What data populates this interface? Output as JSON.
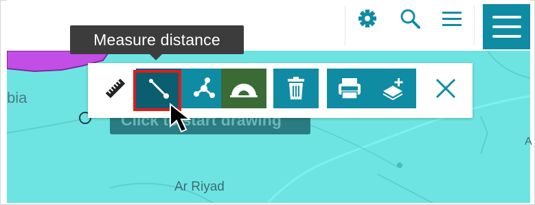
{
  "header": {
    "settings_icon": "gear-icon",
    "search_icon": "search-icon",
    "list_icon": "list-icon",
    "menu_icon": "hamburger-menu-icon",
    "accent_color": "#0f8ca3"
  },
  "tooltip": {
    "text": "Measure distance"
  },
  "toolbar": {
    "tools": [
      {
        "icon": "ruler-icon"
      },
      {
        "icon": "measure-distance-icon",
        "selected": true
      },
      {
        "icon": "measure-area-icon"
      },
      {
        "icon": "measure-angle-icon"
      },
      {
        "icon": "trash-icon"
      },
      {
        "icon": "export-json-icon"
      },
      {
        "icon": "add-layer-icon"
      },
      {
        "icon": "close-icon"
      }
    ],
    "selected_outline_color": "#e01b1b"
  },
  "map": {
    "hint_text": "Click to start drawing",
    "labels": {
      "region_partial": "bia",
      "city": "Ar Riyad",
      "edge_partial": "A"
    },
    "water_color": "#6ee4e2",
    "region_color": "#c24ee6"
  }
}
